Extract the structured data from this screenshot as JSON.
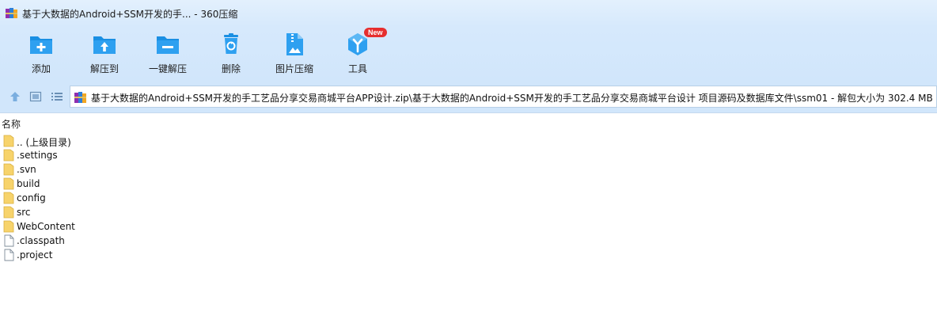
{
  "window": {
    "title": "基于大数据的Android+SSM开发的手... - 360压缩",
    "app_icon": "winrar-books-icon"
  },
  "toolbar": {
    "items": [
      {
        "label": "添加",
        "icon": "add-folder-icon"
      },
      {
        "label": "解压到",
        "icon": "extract-to-icon"
      },
      {
        "label": "一键解压",
        "icon": "one-click-extract-icon"
      },
      {
        "label": "删除",
        "icon": "trash-icon"
      },
      {
        "label": "图片压缩",
        "icon": "image-compress-icon"
      },
      {
        "label": "工具",
        "icon": "tools-icon",
        "badge": "New"
      }
    ]
  },
  "addressbar": {
    "path": "基于大数据的Android+SSM开发的手工艺品分享交易商城平台APP设计.zip\\基于大数据的Android+SSM开发的手工艺品分享交易商城平台设计 项目源码及数据库文件\\ssm01 - 解包大小为 302.4 MB"
  },
  "list": {
    "column_name": "名称",
    "items": [
      {
        "name": ".. (上级目录)",
        "type": "folder"
      },
      {
        "name": ".settings",
        "type": "folder"
      },
      {
        "name": ".svn",
        "type": "folder"
      },
      {
        "name": "build",
        "type": "folder"
      },
      {
        "name": "config",
        "type": "folder"
      },
      {
        "name": "src",
        "type": "folder"
      },
      {
        "name": "WebContent",
        "type": "folder"
      },
      {
        "name": ".classpath",
        "type": "file"
      },
      {
        "name": ".project",
        "type": "file"
      }
    ]
  },
  "colors": {
    "accent": "#1a8fe3",
    "toolbar_bg": "#d6e9fc",
    "folder": "#f7d36b",
    "badge": "#e62e2e"
  }
}
